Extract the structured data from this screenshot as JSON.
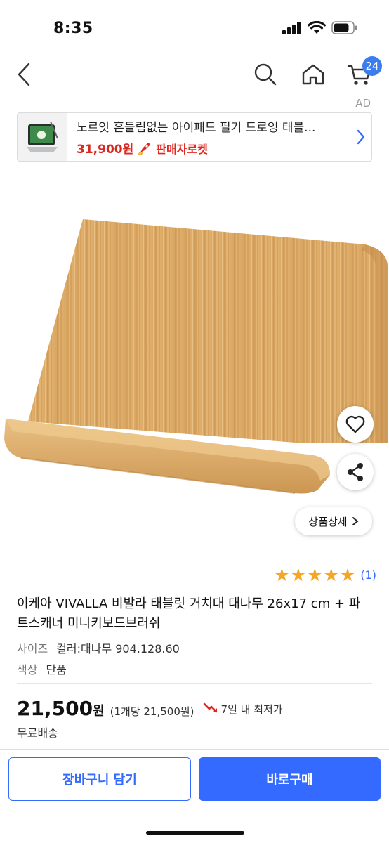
{
  "status_bar": {
    "time": "8:35"
  },
  "nav": {
    "cart_count": "24"
  },
  "ad": {
    "label": "AD",
    "title": "노르잇 흔들림없는 아이패드 필기 드로잉 태블...",
    "price": "31,900원",
    "rocket_label": "판매자로켓"
  },
  "product": {
    "detail_button": "상품상세",
    "rating_stars": 5,
    "review_count": "(1)",
    "title": "이케아 VIVALLA 비발라 태블릿 거치대 대나무 26x17 cm + 파트스캐너 미니키보드브러쉬",
    "options": [
      {
        "label": "사이즈",
        "value": "컬러:대나무 904.128.60"
      },
      {
        "label": "색상",
        "value": "단품"
      }
    ],
    "price": "21,500",
    "price_unit": "원",
    "price_per_unit": "(1개당 21,500원)",
    "lowest_label": "7일 내 최저가",
    "shipping": "무료배송"
  },
  "actions": {
    "cart_button": "장바구니 담기",
    "buy_button": "바로구매"
  },
  "colors": {
    "accent": "#346aff",
    "badge": "#3b7ded",
    "star": "#f5a623",
    "ad_price": "#d9281f"
  }
}
